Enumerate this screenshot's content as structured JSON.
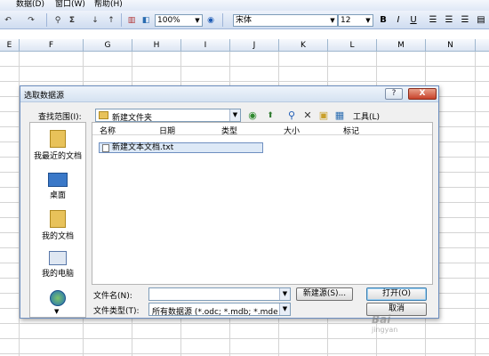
{
  "menubar": {
    "items": [
      "数据(D)",
      "窗口(W)",
      "帮助(H)"
    ]
  },
  "toolbar": {
    "zoom": "100%",
    "font_name": "宋体",
    "font_size": "12",
    "sigma": "Σ",
    "format_bold": "B",
    "format_italic": "I",
    "format_underline": "U"
  },
  "columns": [
    "E",
    "F",
    "G",
    "H",
    "I",
    "J",
    "K",
    "L",
    "M",
    "N"
  ],
  "dialog": {
    "title": "选取数据源",
    "help_btn": "?",
    "close_btn": "X",
    "look_in_label": "查找范围(I):",
    "look_in_value": "新建文件夹",
    "tools_label": "工具(L)",
    "headers": {
      "name": "名称",
      "date": "日期",
      "type": "类型",
      "size": "大小",
      "tags": "标记"
    },
    "files": [
      {
        "name": "新建文本文档.txt"
      }
    ],
    "places": [
      {
        "label": "我最近的文档",
        "icon": "folder-recent-icon"
      },
      {
        "label": "桌面",
        "icon": "desktop-icon"
      },
      {
        "label": "我的文档",
        "icon": "my-documents-icon"
      },
      {
        "label": "我的电脑",
        "icon": "computer-icon"
      },
      {
        "label": "",
        "icon": "network-globe-icon"
      }
    ],
    "filename_label": "文件名(N):",
    "filename_value": "",
    "filetype_label": "文件类型(T):",
    "filetype_value": "所有数据源 (*.odc; *.mdb; *.mde",
    "new_source_btn": "新建源(S)...",
    "open_btn": "打开(O)",
    "cancel_btn": "取消"
  },
  "watermark": {
    "text": "Bai",
    "sub": "jingyan"
  },
  "colors": {
    "accent": "#3c7fb1",
    "titlebar": "#d5e2f1",
    "close": "#c7422a",
    "selection": "#dde9f7"
  }
}
